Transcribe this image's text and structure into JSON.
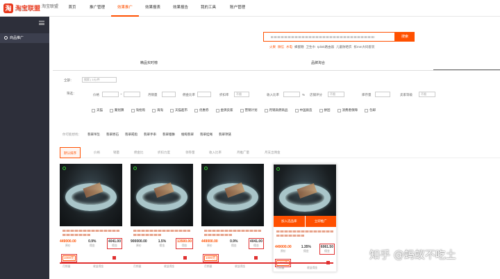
{
  "brand": {
    "name": "淘宝联盟",
    "sub": "淘宝联盟推广平台",
    "side": "淘宝联盟"
  },
  "nav": [
    "首页",
    "推广管理",
    "效果推广",
    "效果报表",
    "效果报告",
    "我的工具",
    "账户管理"
  ],
  "nav_active": 2,
  "sidebar": {
    "item": "商品推广"
  },
  "search": {
    "button": "搜索",
    "hot": [
      "火果",
      "微信",
      "水电",
      "蜂蜜糖",
      "卫生巾",
      "tplink路由器",
      "儿童防晒衣",
      "拆mm大码套装"
    ]
  },
  "tabs": [
    "精品实时榜",
    "品牌淘合"
  ],
  "filter": {
    "all_label": "全部：",
    "all_select": "搜索 | 1元/件",
    "filter_label": "筛选：",
    "row1": [
      "价格",
      "月销量",
      "佣金比率",
      "折扣率",
      "收入比率",
      "店铺评分",
      "库存量",
      "卖家等级"
    ],
    "percent": "%",
    "dash": "~",
    "unlimited": "不限",
    "checks": [
      "天猫",
      "聚划算",
      "淘抢购",
      "海淘",
      "天猫超市",
      "优惠券",
      "金牌卖家",
      "营销计划",
      "月销高佣商品",
      "中国质造",
      "拼团",
      "消费者保障",
      "包邮"
    ]
  },
  "quick": {
    "label": "你可能想找：",
    "items": [
      "翡翠吊坠",
      "翡翠原石",
      "翡翠戒指",
      "翡翠手串",
      "翡翠貔貅",
      "缅甸翡翠",
      "翡翠挂绳",
      "翡翠项链"
    ]
  },
  "sort": [
    "默认排序",
    "价格",
    "销量",
    "佣金比",
    "折扣力度",
    "领券量",
    "收入比率",
    "月推广量",
    "月支出佣金"
  ],
  "cards": [
    {
      "price": "449000.00",
      "price_label": "原价",
      "rate": "0.9%",
      "rate_label": "佣金",
      "commission": "4041.00",
      "commission_label": "佣金",
      "tag": "1000元",
      "foot_left": "月销量",
      "foot_right": "收益佣金"
    },
    {
      "price": "900000.00",
      "price_label": "原价",
      "rate": "1.5%",
      "rate_label": "佣金",
      "commission": "13500.00",
      "commission_label": "佣金",
      "tag": "",
      "foot_left": "月销量",
      "foot_right": "收益佣金"
    },
    {
      "price": "449000.00",
      "price_label": "原价",
      "rate": "0.9%",
      "rate_label": "佣金",
      "commission": "4041.00",
      "commission_label": "佣金",
      "tag": "1000元",
      "foot_left": "月销量",
      "foot_right": "收益佣金"
    },
    {
      "price": "449000.00",
      "price_label": "原价",
      "rate": "1.35%",
      "rate_label": "佣金",
      "commission": "6061.50",
      "commission_label": "佣金",
      "tag": "1000元",
      "foot_left": "月销量",
      "foot_right": "收益佣金",
      "btn_left": "加入选品库",
      "btn_right": "立即推广"
    }
  ],
  "watermark": "知乎 @蚂蚁不吃土",
  "colors": {
    "accent": "#ff5000",
    "sidebar": "#2d2f3a",
    "highlight": "#e03030"
  }
}
